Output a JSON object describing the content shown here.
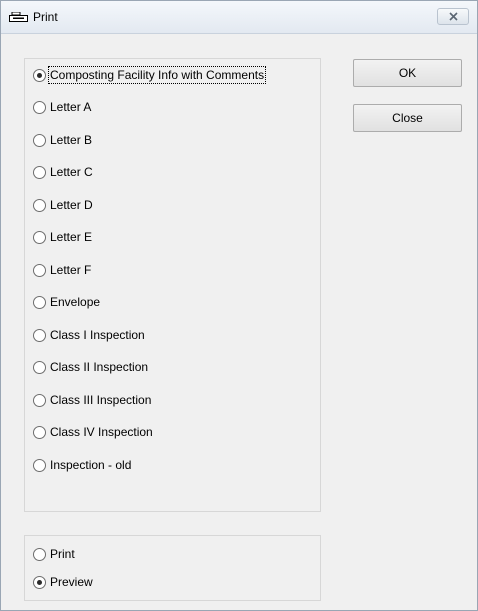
{
  "window": {
    "title": "Print"
  },
  "report_options": [
    {
      "label": "Composting Facility Info with Comments",
      "checked": true
    },
    {
      "label": "Letter A",
      "checked": false
    },
    {
      "label": "Letter B",
      "checked": false
    },
    {
      "label": "Letter C",
      "checked": false
    },
    {
      "label": "Letter D",
      "checked": false
    },
    {
      "label": "Letter E",
      "checked": false
    },
    {
      "label": "Letter F",
      "checked": false
    },
    {
      "label": "Envelope",
      "checked": false
    },
    {
      "label": "Class I Inspection",
      "checked": false
    },
    {
      "label": "Class II Inspection",
      "checked": false
    },
    {
      "label": "Class III Inspection",
      "checked": false
    },
    {
      "label": "Class IV Inspection",
      "checked": false
    },
    {
      "label": "Inspection - old",
      "checked": false
    }
  ],
  "output_options": [
    {
      "label": "Print",
      "checked": false
    },
    {
      "label": "Preview",
      "checked": true
    }
  ],
  "buttons": {
    "ok_label": "OK",
    "close_label": "Close"
  }
}
